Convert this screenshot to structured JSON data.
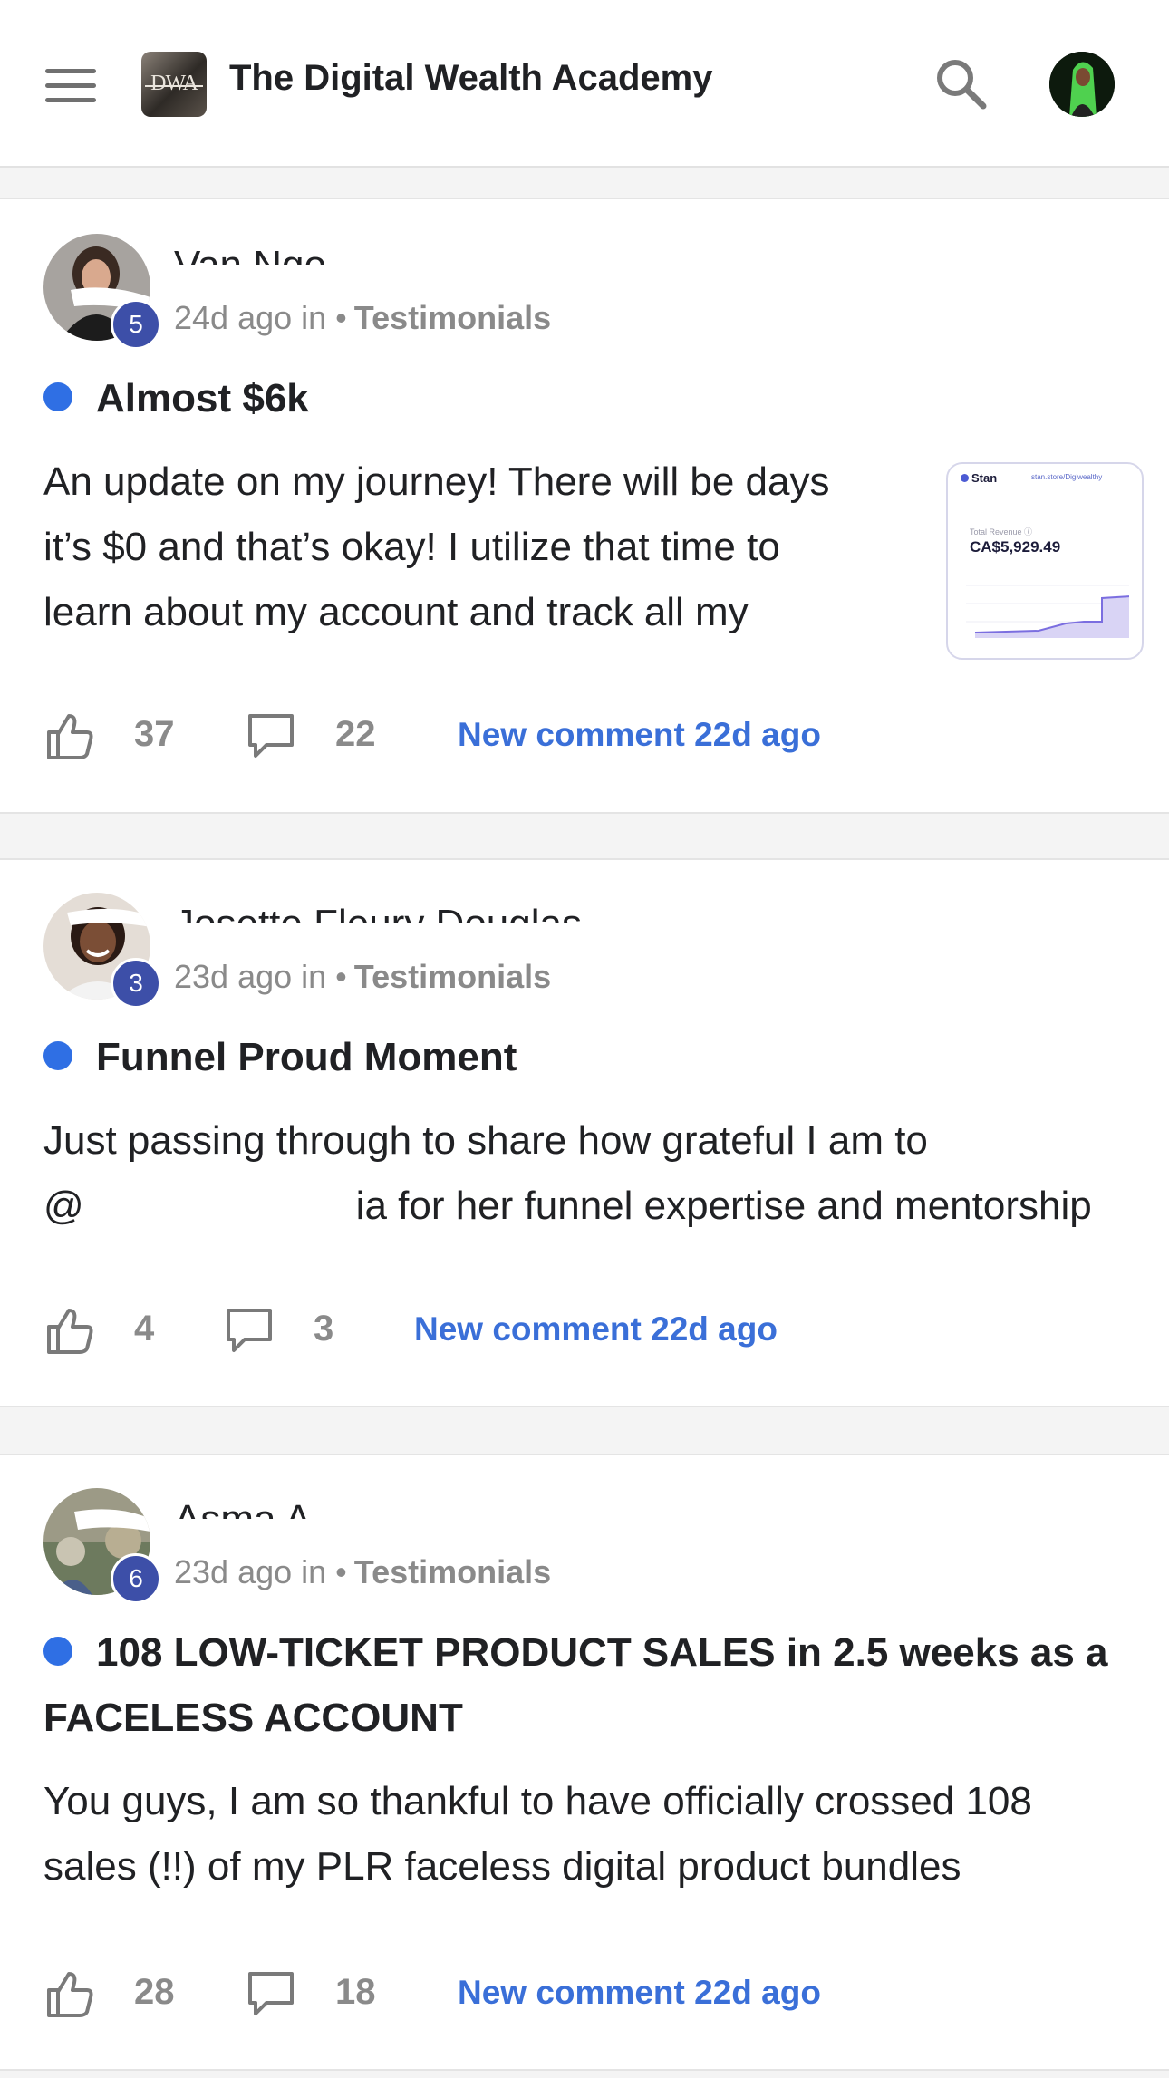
{
  "header": {
    "logo_text": "DWA",
    "app_title": "The Digital Wealth Academy"
  },
  "posts": [
    {
      "author": "Van Ngo",
      "level": "5",
      "time": "24d ago in",
      "separator": "•",
      "category": "Testimonials",
      "title": "Almost $6k",
      "body_lines": [
        "An update on my journey! There will be days",
        "it’s $0 and that’s okay! I utilize that time to",
        "learn about my account and track all my"
      ],
      "likes": "37",
      "comments": "22",
      "new_comment": "New comment 22d ago",
      "thumbnail": {
        "brand": "Stan",
        "url": "stan.store/Digiwealthy",
        "label": "Total Revenue ⓘ",
        "value": "CA$5,929.49"
      }
    },
    {
      "author": "Josette Fleury Douglas",
      "level": "3",
      "time": "23d ago in",
      "separator": "•",
      "category": "Testimonials",
      "title": "Funnel Proud Moment",
      "body_lines": [
        "Just passing through to share how grateful I am to",
        "@",
        "ia for her funnel expertise and mentorship"
      ],
      "likes": "4",
      "comments": "3",
      "new_comment": "New comment 22d ago"
    },
    {
      "author": "Asma A",
      "level": "6",
      "time": "23d ago in",
      "separator": "•",
      "category": "Testimonials",
      "title": "108 LOW-TICKET PRODUCT SALES in 2.5 weeks as a FACELESS ACCOUNT",
      "body_lines": [
        "You guys, I am so thankful to have officially crossed 108",
        "sales (!!) of my PLR faceless digital product bundles"
      ],
      "likes": "28",
      "comments": "18",
      "new_comment": "New comment 22d ago"
    }
  ],
  "colors": {
    "accent_blue": "#3a6fd8",
    "unread_dot": "#2f6fe4",
    "level_badge": "#3d4fa8",
    "muted_text": "#8a8a8a"
  },
  "icons": [
    "menu-icon",
    "search-icon",
    "like-icon",
    "comment-icon"
  ]
}
